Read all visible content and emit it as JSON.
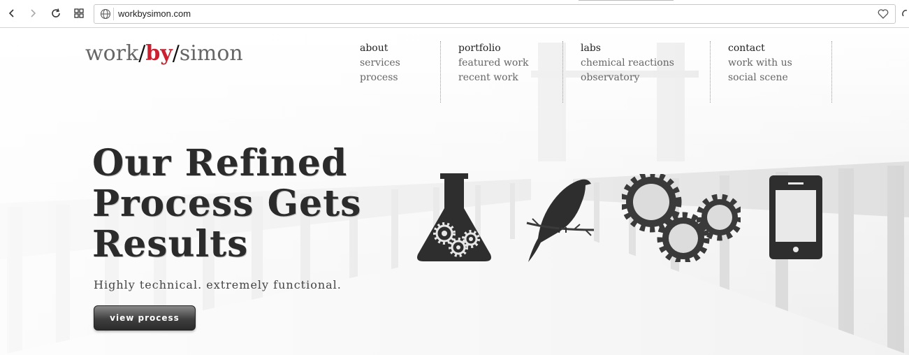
{
  "browser": {
    "url": "workbysimon.com"
  },
  "site": {
    "logo": {
      "part1": "work",
      "slash1": "/",
      "part2": "by",
      "slash2": "/",
      "part3": "simon"
    },
    "nav": [
      {
        "heading": "about",
        "items": [
          "services",
          "process"
        ]
      },
      {
        "heading": "portfolio",
        "items": [
          "featured work",
          "recent work"
        ]
      },
      {
        "heading": "labs",
        "items": [
          "chemical reactions",
          "observatory"
        ]
      },
      {
        "heading": "contact",
        "items": [
          "work with us",
          "social scene"
        ]
      }
    ],
    "hero": {
      "title": "Our Refined\nProcess Gets\nResults",
      "tagline": "Highly technical. extremely functional.",
      "cta_label": "view process"
    },
    "icons": [
      "flask-gears-icon",
      "bird-icon",
      "gears-icon",
      "tablet-icon"
    ],
    "colors": {
      "accent": "#cc1f2f",
      "dark": "#2b2b2b",
      "text": "#666666"
    }
  }
}
